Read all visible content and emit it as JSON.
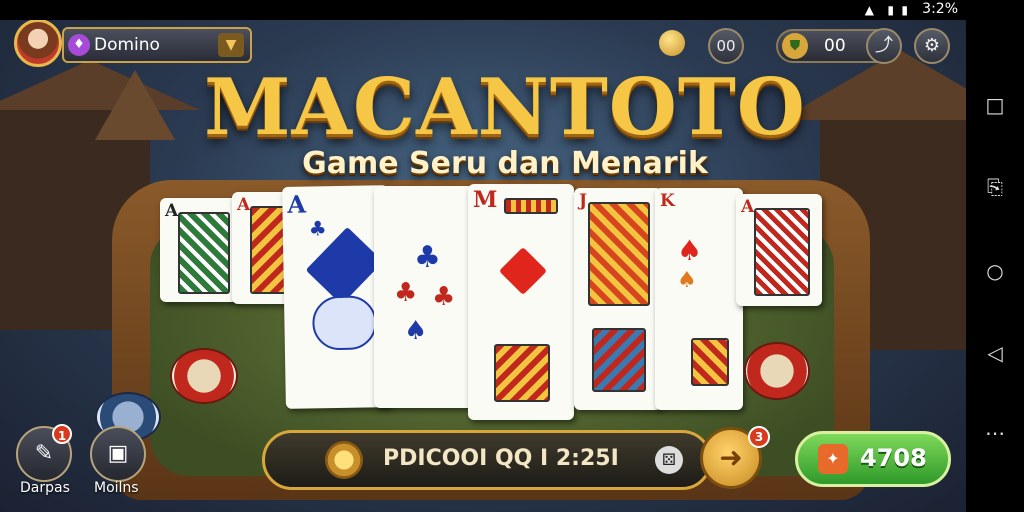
{
  "status": {
    "time": "3:2%"
  },
  "player": {
    "name": "Domino",
    "name_icon": "gem-icon"
  },
  "top": {
    "chip_a": "00",
    "chip_b": "00"
  },
  "title": "MACANTOTO",
  "subtitle": "Game Seru dan Menarik",
  "cards": [
    {
      "rank": "A",
      "color": "#222"
    },
    {
      "rank": "A",
      "color": "#c0281e"
    },
    {
      "rank": "A",
      "color": "#1e3aa8"
    },
    {
      "rank": "",
      "color": "#1e3aa8"
    },
    {
      "rank": "M",
      "color": "#c0281e"
    },
    {
      "rank": "J",
      "color": "#c0281e"
    },
    {
      "rank": "K",
      "color": "#c0281e"
    },
    {
      "rank": "A",
      "color": "#c0281e"
    }
  ],
  "bottom": {
    "left_button_label": "Darpas",
    "left_badge": "1",
    "right_button_label": "Moilns",
    "bar_text": "PDICOOI QQ I 2:25I",
    "go_badge": "3",
    "green_value": "4708"
  },
  "colors": {
    "gold": "#f6c646",
    "felt": "#4f6330",
    "green": "#3fb034"
  }
}
